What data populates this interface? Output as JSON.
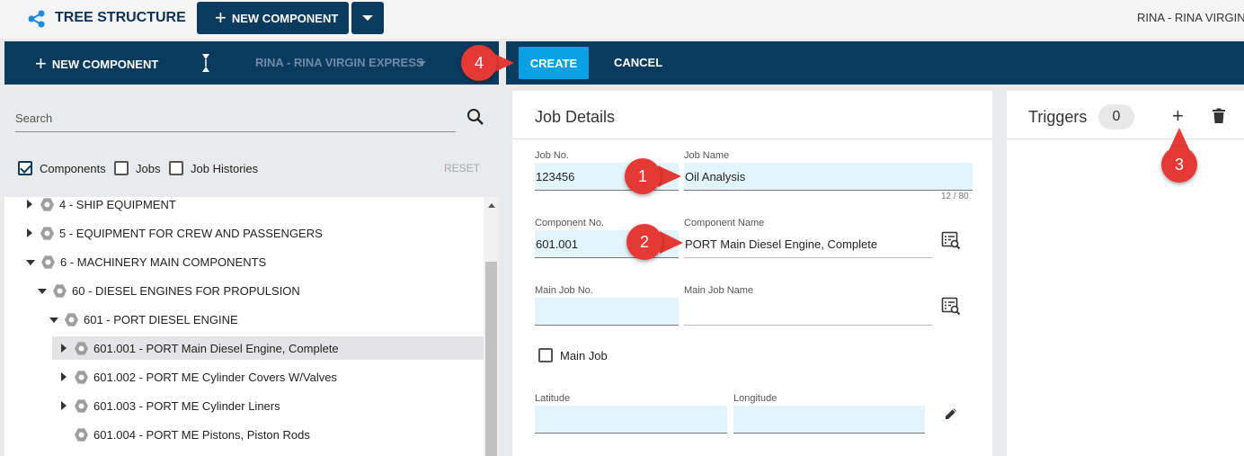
{
  "app": {
    "title": "TREE STRUCTURE",
    "new_component": "NEW COMPONENT",
    "user": "RINA - RINA VIRGIN EXPRESS"
  },
  "toolbar": {
    "new_component": "NEW COMPONENT",
    "vessel": "RINA - RINA VIRGIN EXPRESS",
    "create": "CREATE",
    "cancel": "CANCEL"
  },
  "sidebar": {
    "search_placeholder": "Search",
    "filters": [
      {
        "label": "Components",
        "checked": true
      },
      {
        "label": "Jobs",
        "checked": false
      },
      {
        "label": "Job Histories",
        "checked": false
      }
    ],
    "reset": "RESET",
    "tree": [
      {
        "label": "4 - SHIP EQUIPMENT",
        "state": "collapsed",
        "level": 0
      },
      {
        "label": "5 - EQUIPMENT FOR CREW AND PASSENGERS",
        "state": "collapsed",
        "level": 0
      },
      {
        "label": "6 - MACHINERY MAIN COMPONENTS",
        "state": "expanded",
        "level": 0
      },
      {
        "label": "60 - DIESEL ENGINES FOR PROPULSION",
        "state": "expanded",
        "level": 1
      },
      {
        "label": "601 - PORT DIESEL ENGINE",
        "state": "expanded",
        "level": 2
      },
      {
        "label": "601.001 - PORT Main Diesel Engine, Complete",
        "state": "collapsed",
        "level": 3,
        "selected": true
      },
      {
        "label": "601.002 - PORT ME Cylinder Covers W/Valves",
        "state": "collapsed",
        "level": 3
      },
      {
        "label": "601.003 - PORT ME Cylinder Liners",
        "state": "collapsed",
        "level": 3
      },
      {
        "label": "601.004 - PORT ME Pistons, Piston Rods",
        "state": "leaf",
        "level": 3
      }
    ]
  },
  "job_details": {
    "title": "Job Details",
    "job_no_label": "Job No.",
    "job_no": "123456",
    "job_name_label": "Job Name",
    "job_name": "Oil Analysis",
    "job_name_counter": "12 / 80",
    "component_no_label": "Component No.",
    "component_no": "601.001",
    "component_name_label": "Component Name",
    "component_name": "PORT Main Diesel Engine, Complete",
    "main_job_no_label": "Main Job No.",
    "main_job_no": "",
    "main_job_name_label": "Main Job Name",
    "main_job_name": "",
    "main_job_label": "Main Job",
    "latitude_label": "Latitude",
    "longitude_label": "Longitude"
  },
  "triggers": {
    "title": "Triggers",
    "count": "0"
  },
  "callouts": [
    "1",
    "2",
    "3",
    "4"
  ],
  "colors": {
    "navy": "#0b3a5f",
    "accent": "#0aa1e4",
    "callout": "#e53935",
    "field": "#e3f5fc"
  }
}
